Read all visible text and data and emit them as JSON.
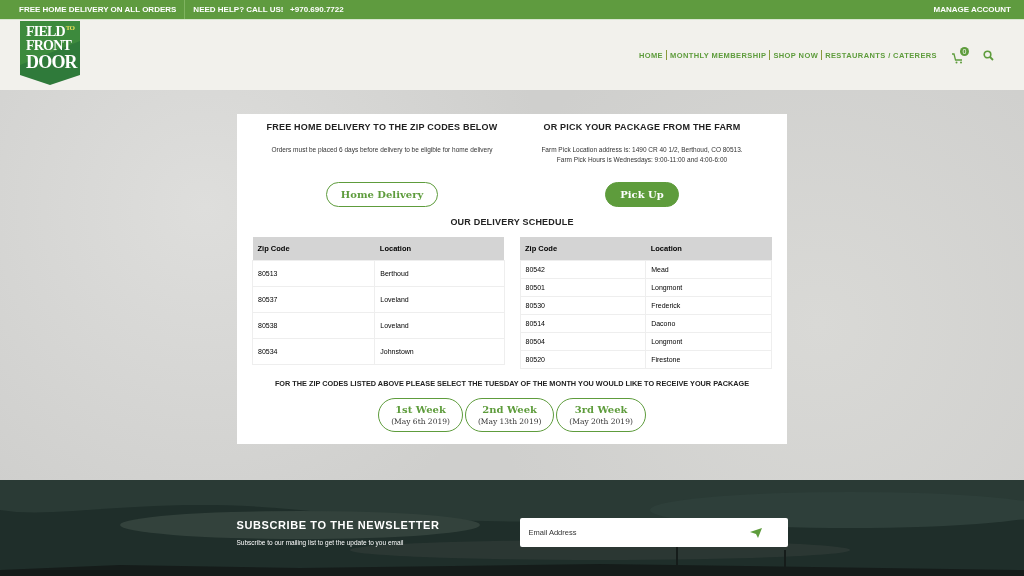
{
  "top_bar": {
    "left": [
      "FREE HOME DELIVERY ON ALL ORDERS",
      "NEED HELP? CALL US!   +970.690.7722"
    ],
    "right": "MANAGE ACCOUNT"
  },
  "logo": {
    "lines": [
      "FIELD",
      "TO",
      "FRONT",
      "DOOR"
    ]
  },
  "nav": {
    "items": [
      "HOME",
      "MONTHLY MEMBERSHIP",
      "SHOP NOW",
      "RESTAURANTS / CATERERS"
    ],
    "cart_count": "0"
  },
  "delivery_options": [
    {
      "title": "FREE HOME DELIVERY TO THE ZIP CODES BELOW",
      "lines": [
        "Orders must be placed 6 days before delivery to be eligible for home delivery"
      ],
      "button": "Home Delivery",
      "selected": false
    },
    {
      "title": "OR PICK YOUR PACKAGE FROM THE FARM",
      "lines": [
        "Farm Pick Location address is: 1490 CR 40 1/2, Berthoud, CO 80513.",
        "Farm Pick Hours is Wednesdays: 9:00-11:00 and 4:00-6:00"
      ],
      "button": "Pick Up",
      "selected": true
    }
  ],
  "schedule": {
    "title": "OUR DELIVERY SCHEDULE",
    "tables": [
      {
        "columns": [
          "Zip Code",
          "Location"
        ],
        "rows": [
          [
            "80513",
            "Berthoud"
          ],
          [
            "80537",
            "Loveland"
          ],
          [
            "80538",
            "Loveland"
          ],
          [
            "80534",
            "Johnstown"
          ]
        ]
      },
      {
        "columns": [
          "Zip Code",
          "Location"
        ],
        "rows": [
          [
            "80542",
            "Mead"
          ],
          [
            "80501",
            "Longmont"
          ],
          [
            "80530",
            "Frederick"
          ],
          [
            "80514",
            "Dacono"
          ],
          [
            "80504",
            "Longmont"
          ],
          [
            "80520",
            "Firestone"
          ]
        ]
      }
    ]
  },
  "week_prompt": "FOR THE ZIP CODES LISTED ABOVE PLEASE SELECT THE TUESDAY OF THE MONTH YOU WOULD LIKE TO RECEIVE YOUR PACKAGE",
  "weeks": [
    {
      "label": "1st Week",
      "date": "(May 6th 2019)",
      "selected": false
    },
    {
      "label": "2nd Week",
      "date": "(May 13th 2019)",
      "selected": false
    },
    {
      "label": "3rd Week",
      "date": "(May 20th 2019)",
      "selected": false
    }
  ],
  "newsletter": {
    "title": "SUBSCRIBE TO THE NEWSLETTER",
    "text": "Subscribe to our mailing list to get the update to you email",
    "placeholder": "Email Address"
  }
}
